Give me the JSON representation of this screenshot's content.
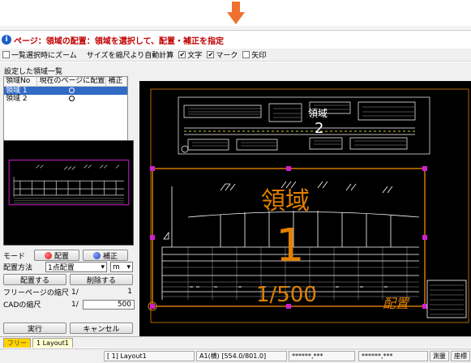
{
  "page": {
    "title": "ページ：領域の配置：領域を選択して、配置・補正を指定"
  },
  "options": [
    {
      "label": "一覧選択時にズーム",
      "checked": false
    },
    {
      "label": "サイズを縮尺より自動計算",
      "checked": null
    },
    {
      "label": "文字",
      "checked": true
    },
    {
      "label": "マーク",
      "checked": true
    },
    {
      "label": "矢印",
      "checked": false
    }
  ],
  "region_list": {
    "section_label": "設定した領域一覧",
    "columns": [
      "領域No",
      "現在のページに配置",
      "補正"
    ],
    "rows": [
      {
        "name": "領域 1",
        "placed": true,
        "selected": true
      },
      {
        "name": "領域 2",
        "placed": true,
        "selected": false
      }
    ]
  },
  "mode": {
    "label": "モード",
    "place_label": "配置",
    "correct_label": "補正",
    "colors": {
      "place": "#e01010",
      "correct": "#2040c0"
    }
  },
  "placement": {
    "method_label": "配置方法",
    "method_value": "1点配置",
    "unit_value": "m",
    "place_button": "配置する",
    "remove_button": "削除する"
  },
  "scales": {
    "free_page_label": "フリーページの縮尺",
    "free_page_prefix": "1/",
    "free_page_value": "1",
    "cad_label": "CADの縮尺",
    "cad_prefix": "1/",
    "cad_value": "500"
  },
  "actions": {
    "execute": "実行",
    "cancel": "キャンセル"
  },
  "canvas": {
    "region1_label": "領域",
    "region1_number": "1",
    "region1_scale": "1/500",
    "region1_status": "配置",
    "region2_label": "領域",
    "region2_number": "2",
    "colors": {
      "frame": "#e08000",
      "handle": "#d020d0",
      "line": "#ffffff",
      "text": "#e08000"
    }
  },
  "bottom_tabs": [
    {
      "label": "フリー",
      "active": false
    },
    {
      "label": "1  Layout1",
      "active": true
    }
  ],
  "status": {
    "layout": "[ 1] Layout1",
    "paper": "A1(横) [554.0/801.0]",
    "coord1": "******,***",
    "coord2": "******,***",
    "measure": "測量",
    "coord_label": "座標"
  }
}
